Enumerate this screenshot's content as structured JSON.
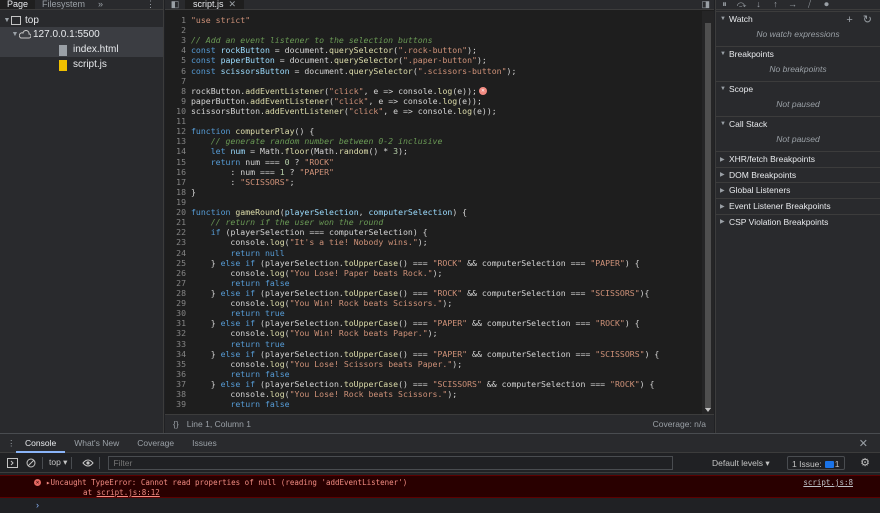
{
  "navigator": {
    "tabs": [
      "Page",
      "Filesystem"
    ],
    "more": "»",
    "menu": "⋮",
    "tree": [
      {
        "label": "top",
        "twisty": "▼",
        "icon": "frame-icon"
      },
      {
        "label": "127.0.0.1:5500",
        "twisty": "▼",
        "icon": "cloud-icon"
      },
      {
        "label": "index.html",
        "icon": "file-icon"
      },
      {
        "label": "script.js",
        "icon": "js-file-icon"
      }
    ]
  },
  "editor": {
    "tab_label": "script.js",
    "tab_close": "✕",
    "code": [
      [
        "1",
        [
          [
            "s",
            "\"use strict\""
          ]
        ]
      ],
      [
        "2",
        []
      ],
      [
        "3",
        [
          [
            "c",
            "// Add an event listener to the selection buttons"
          ]
        ]
      ],
      [
        "4",
        [
          [
            "k",
            "const "
          ],
          [
            "v",
            "rockButton"
          ],
          [
            "p",
            " = document."
          ],
          [
            "f",
            "querySelector"
          ],
          [
            "p",
            "("
          ],
          [
            "s",
            "\".rock-button\""
          ],
          [
            "p",
            ");"
          ]
        ]
      ],
      [
        "5",
        [
          [
            "k",
            "const "
          ],
          [
            "v",
            "paperButton"
          ],
          [
            "p",
            " = document."
          ],
          [
            "f",
            "querySelector"
          ],
          [
            "p",
            "("
          ],
          [
            "s",
            "\".paper-button\""
          ],
          [
            "p",
            ");"
          ]
        ]
      ],
      [
        "6",
        [
          [
            "k",
            "const "
          ],
          [
            "v",
            "scissorsButton"
          ],
          [
            "p",
            " = document."
          ],
          [
            "f",
            "querySelector"
          ],
          [
            "p",
            "("
          ],
          [
            "s",
            "\".scissors-button\""
          ],
          [
            "p",
            ");"
          ]
        ]
      ],
      [
        "7",
        []
      ],
      [
        "8",
        [
          [
            "p",
            "rockButton."
          ],
          [
            "f",
            "addEventListener"
          ],
          [
            "p",
            "("
          ],
          [
            "s",
            "\"click\""
          ],
          [
            "p",
            ", e => console."
          ],
          [
            "f",
            "log"
          ],
          [
            "p",
            "(e));"
          ],
          [
            "e",
            ""
          ]
        ]
      ],
      [
        "9",
        [
          [
            "p",
            "paperButton."
          ],
          [
            "f",
            "addEventListener"
          ],
          [
            "p",
            "("
          ],
          [
            "s",
            "\"click\""
          ],
          [
            "p",
            ", e => console."
          ],
          [
            "f",
            "log"
          ],
          [
            "p",
            "(e));"
          ]
        ]
      ],
      [
        "10",
        [
          [
            "p",
            "scissorsButton."
          ],
          [
            "f",
            "addEventListener"
          ],
          [
            "p",
            "("
          ],
          [
            "s",
            "\"click\""
          ],
          [
            "p",
            ", e => console."
          ],
          [
            "f",
            "log"
          ],
          [
            "p",
            "(e));"
          ]
        ]
      ],
      [
        "11",
        []
      ],
      [
        "12",
        [
          [
            "k",
            "function "
          ],
          [
            "f",
            "computerPlay"
          ],
          [
            "p",
            "() {"
          ]
        ]
      ],
      [
        "13",
        [
          [
            "p",
            "    "
          ],
          [
            "c",
            "// generate random number between 0-2 inclusive"
          ]
        ]
      ],
      [
        "14",
        [
          [
            "p",
            "    "
          ],
          [
            "k",
            "let "
          ],
          [
            "v",
            "num"
          ],
          [
            "p",
            " = Math."
          ],
          [
            "f",
            "floor"
          ],
          [
            "p",
            "(Math."
          ],
          [
            "f",
            "random"
          ],
          [
            "p",
            "() * "
          ],
          [
            "n",
            "3"
          ],
          [
            "p",
            ");"
          ]
        ]
      ],
      [
        "15",
        [
          [
            "p",
            "    "
          ],
          [
            "k",
            "return "
          ],
          [
            "p",
            "num === "
          ],
          [
            "n",
            "0"
          ],
          [
            "p",
            " ? "
          ],
          [
            "s",
            "\"ROCK\""
          ]
        ]
      ],
      [
        "16",
        [
          [
            "p",
            "        : num === "
          ],
          [
            "n",
            "1"
          ],
          [
            "p",
            " ? "
          ],
          [
            "s",
            "\"PAPER\""
          ]
        ]
      ],
      [
        "17",
        [
          [
            "p",
            "        : "
          ],
          [
            "s",
            "\"SCISSORS\""
          ],
          [
            "p",
            ";"
          ]
        ]
      ],
      [
        "18",
        [
          [
            "p",
            "}"
          ]
        ]
      ],
      [
        "19",
        []
      ],
      [
        "20",
        [
          [
            "k",
            "function "
          ],
          [
            "f",
            "gameRound"
          ],
          [
            "p",
            "("
          ],
          [
            "v",
            "playerSelection"
          ],
          [
            "p",
            ", "
          ],
          [
            "v",
            "computerSelection"
          ],
          [
            "p",
            ") {"
          ]
        ]
      ],
      [
        "21",
        [
          [
            "p",
            "    "
          ],
          [
            "c",
            "// return if the user won the round"
          ]
        ]
      ],
      [
        "22",
        [
          [
            "p",
            "    "
          ],
          [
            "k",
            "if "
          ],
          [
            "p",
            "(playerSelection === computerSelection) {"
          ]
        ]
      ],
      [
        "23",
        [
          [
            "p",
            "        console."
          ],
          [
            "f",
            "log"
          ],
          [
            "p",
            "("
          ],
          [
            "s",
            "\"It's a tie! Nobody wins.\""
          ],
          [
            "p",
            ");"
          ]
        ]
      ],
      [
        "24",
        [
          [
            "p",
            "        "
          ],
          [
            "k",
            "return null"
          ]
        ]
      ],
      [
        "25",
        [
          [
            "p",
            "    } "
          ],
          [
            "k",
            "else if "
          ],
          [
            "p",
            "(playerSelection."
          ],
          [
            "f",
            "toUpperCase"
          ],
          [
            "p",
            "() === "
          ],
          [
            "s",
            "\"ROCK\""
          ],
          [
            "p",
            " && computerSelection === "
          ],
          [
            "s",
            "\"PAPER\""
          ],
          [
            "p",
            ") {"
          ]
        ]
      ],
      [
        "26",
        [
          [
            "p",
            "        console."
          ],
          [
            "f",
            "log"
          ],
          [
            "p",
            "("
          ],
          [
            "s",
            "\"You Lose! Paper beats Rock.\""
          ],
          [
            "p",
            ");"
          ]
        ]
      ],
      [
        "27",
        [
          [
            "p",
            "        "
          ],
          [
            "k",
            "return false"
          ]
        ]
      ],
      [
        "28",
        [
          [
            "p",
            "    } "
          ],
          [
            "k",
            "else if "
          ],
          [
            "p",
            "(playerSelection."
          ],
          [
            "f",
            "toUpperCase"
          ],
          [
            "p",
            "() === "
          ],
          [
            "s",
            "\"ROCK\""
          ],
          [
            "p",
            " && computerSelection === "
          ],
          [
            "s",
            "\"SCISSORS\""
          ],
          [
            "p",
            "){"
          ]
        ]
      ],
      [
        "29",
        [
          [
            "p",
            "        console."
          ],
          [
            "f",
            "log"
          ],
          [
            "p",
            "("
          ],
          [
            "s",
            "\"You Win! Rock beats Scissors.\""
          ],
          [
            "p",
            ");"
          ]
        ]
      ],
      [
        "30",
        [
          [
            "p",
            "        "
          ],
          [
            "k",
            "return true"
          ]
        ]
      ],
      [
        "31",
        [
          [
            "p",
            "    } "
          ],
          [
            "k",
            "else if "
          ],
          [
            "p",
            "(playerSelection."
          ],
          [
            "f",
            "toUpperCase"
          ],
          [
            "p",
            "() === "
          ],
          [
            "s",
            "\"PAPER\""
          ],
          [
            "p",
            " && computerSelection === "
          ],
          [
            "s",
            "\"ROCK\""
          ],
          [
            "p",
            ") {"
          ]
        ]
      ],
      [
        "32",
        [
          [
            "p",
            "        console."
          ],
          [
            "f",
            "log"
          ],
          [
            "p",
            "("
          ],
          [
            "s",
            "\"You Win! Rock beats Paper.\""
          ],
          [
            "p",
            ");"
          ]
        ]
      ],
      [
        "33",
        [
          [
            "p",
            "        "
          ],
          [
            "k",
            "return true"
          ]
        ]
      ],
      [
        "34",
        [
          [
            "p",
            "    } "
          ],
          [
            "k",
            "else if "
          ],
          [
            "p",
            "(playerSelection."
          ],
          [
            "f",
            "toUpperCase"
          ],
          [
            "p",
            "() === "
          ],
          [
            "s",
            "\"PAPER\""
          ],
          [
            "p",
            " && computerSelection === "
          ],
          [
            "s",
            "\"SCISSORS\""
          ],
          [
            "p",
            ") {"
          ]
        ]
      ],
      [
        "35",
        [
          [
            "p",
            "        console."
          ],
          [
            "f",
            "log"
          ],
          [
            "p",
            "("
          ],
          [
            "s",
            "\"You Lose! Scissors beats Paper.\""
          ],
          [
            "p",
            ");"
          ]
        ]
      ],
      [
        "36",
        [
          [
            "p",
            "        "
          ],
          [
            "k",
            "return false"
          ]
        ]
      ],
      [
        "37",
        [
          [
            "p",
            "    } "
          ],
          [
            "k",
            "else if "
          ],
          [
            "p",
            "(playerSelection."
          ],
          [
            "f",
            "toUpperCase"
          ],
          [
            "p",
            "() === "
          ],
          [
            "s",
            "\"SCISSORS\""
          ],
          [
            "p",
            " && computerSelection === "
          ],
          [
            "s",
            "\"ROCK\""
          ],
          [
            "p",
            ") {"
          ]
        ]
      ],
      [
        "38",
        [
          [
            "p",
            "        console."
          ],
          [
            "f",
            "log"
          ],
          [
            "p",
            "("
          ],
          [
            "s",
            "\"You Lose! Rock beats Scissors.\""
          ],
          [
            "p",
            ");"
          ]
        ]
      ],
      [
        "39",
        [
          [
            "p",
            "        "
          ],
          [
            "k",
            "return false"
          ]
        ]
      ]
    ],
    "status_brace": "{}",
    "cursor_position": "Line 1, Column 1",
    "coverage": "Coverage: n/a"
  },
  "debugger": {
    "toolbar_icons": [
      "pause-icon",
      "step-over-icon",
      "step-into-icon",
      "step-out-icon",
      "step-icon",
      "deactivate-breakpoints-icon",
      "pause-on-exceptions-icon"
    ],
    "toolbar_glyphs": [
      "⏸",
      "⤼",
      "↓",
      "↑",
      "→",
      "⧸",
      "⏺"
    ],
    "sections": [
      {
        "label": "Watch",
        "open": true,
        "empty": "No watch expressions",
        "actions": [
          "+",
          "↻"
        ]
      },
      {
        "label": "Breakpoints",
        "open": true,
        "empty": "No breakpoints"
      },
      {
        "label": "Scope",
        "open": true,
        "empty": "Not paused"
      },
      {
        "label": "Call Stack",
        "open": true,
        "empty": "Not paused"
      },
      {
        "label": "XHR/fetch Breakpoints",
        "open": false
      },
      {
        "label": "DOM Breakpoints",
        "open": false
      },
      {
        "label": "Global Listeners",
        "open": false
      },
      {
        "label": "Event Listener Breakpoints",
        "open": false
      },
      {
        "label": "CSP Violation Breakpoints",
        "open": false
      }
    ]
  },
  "drawer": {
    "menu": "⋮",
    "tabs": [
      "Console",
      "What's New",
      "Coverage",
      "Issues"
    ],
    "close": "✕"
  },
  "console": {
    "context": "top ▾",
    "filter_placeholder": "Filter",
    "levels": "Default levels ▾",
    "issues_label": "1 Issue:",
    "issues_count": "1",
    "settings": "⚙",
    "error": {
      "message": "▸Uncaught TypeError: Cannot read properties of null (reading 'addEventListener')",
      "at_prefix": "    at ",
      "at_link": "script.js:8:12",
      "source": "script.js:8"
    },
    "prompt": "›"
  },
  "colors": {
    "keyword": "#569cd6",
    "string": "#ce9178",
    "comment": "#6a9955",
    "function": "#dcdcaa",
    "variable": "#9cdcfe",
    "number": "#b5cea8",
    "punct": "#d4d4d4",
    "error_bg": "#290000",
    "error_text": "#f28b82",
    "accent": "#8ab4f8"
  }
}
